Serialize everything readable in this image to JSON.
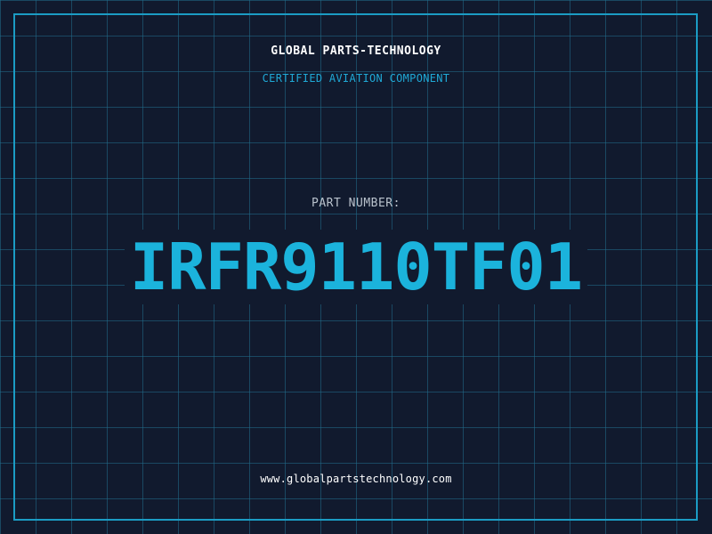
{
  "colors": {
    "background": "#111a2e",
    "grid": "#206e8c",
    "accent": "#1bb3dc",
    "frame": "#1b9cc4",
    "label": "#b9c2cc",
    "text": "#ffffff"
  },
  "header": {
    "company": "GLOBAL PARTS-TECHNOLOGY",
    "tagline": "CERTIFIED AVIATION COMPONENT"
  },
  "main": {
    "label": "PART NUMBER:",
    "part_number": "IRFR9110TF01"
  },
  "footer": {
    "url": "www.globalpartstechnology.com"
  }
}
